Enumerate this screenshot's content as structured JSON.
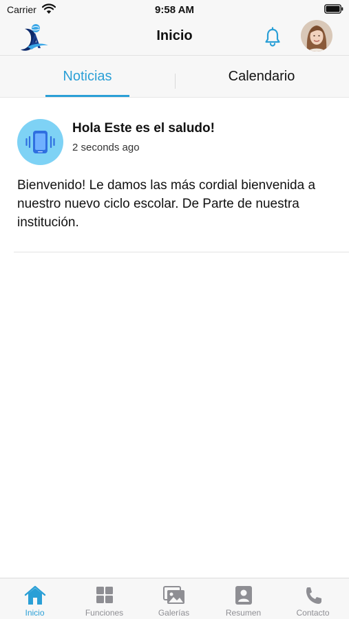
{
  "status_bar": {
    "carrier": "Carrier",
    "time": "9:58 AM"
  },
  "header": {
    "title": "Inicio",
    "logo_icon": "school-globe-logo",
    "notifications_icon": "bell-icon",
    "avatar_icon": "user-avatar"
  },
  "tabs": [
    {
      "label": "Noticias",
      "selected": true
    },
    {
      "label": "Calendario",
      "selected": false
    }
  ],
  "news": [
    {
      "icon": "phone-vibrate-icon",
      "title": "Hola Este es el saludo!",
      "time": "2 seconds ago",
      "body": "Bienvenido! Le damos las más cordial bienvenida a nuestro nuevo ciclo escolar. De Parte de nuestra institución."
    }
  ],
  "tab_bar": [
    {
      "label": "Inicio",
      "icon": "home-icon",
      "active": true
    },
    {
      "label": "Funciones",
      "icon": "grid-icon",
      "active": false
    },
    {
      "label": "Galerías",
      "icon": "gallery-icon",
      "active": false
    },
    {
      "label": "Resumen",
      "icon": "profile-card-icon",
      "active": false
    },
    {
      "label": "Contacto",
      "icon": "phone-icon",
      "active": false
    }
  ],
  "colors": {
    "accent": "#2a9fd6",
    "inactive": "#8e8e93",
    "bar_background": "#f7f7f7",
    "news_icon_background": "#7ed2f5"
  }
}
